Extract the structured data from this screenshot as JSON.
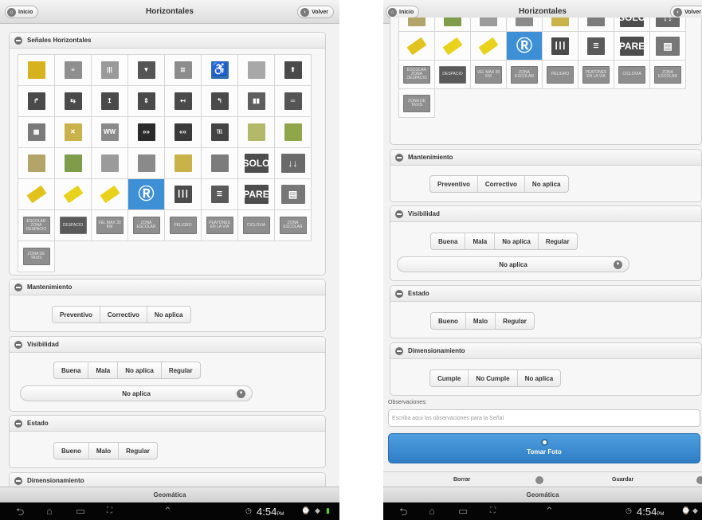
{
  "header": {
    "title": "Horizontales",
    "home_label": "Inicio",
    "back_label": "Volver"
  },
  "signals": {
    "title": "Señales Horizontales",
    "tiles": [
      {
        "label": "",
        "color": "#d6b21f",
        "kind": "hatch-yellow"
      },
      {
        "label": "≡",
        "color": "#8f8f8f",
        "kind": "bars"
      },
      {
        "label": "|||",
        "color": "#9a9a9a",
        "kind": "bars"
      },
      {
        "label": "▼",
        "color": "#555555",
        "kind": "yield"
      },
      {
        "label": "≣",
        "color": "#8c8c8c",
        "kind": "bars"
      },
      {
        "label": "♿",
        "color": "#2d6fb0",
        "kind": "accessible"
      },
      {
        "label": "",
        "color": "#a8a8a8",
        "kind": "plain"
      },
      {
        "label": "⬆",
        "color": "#4a4a4a",
        "kind": "arrow"
      },
      {
        "label": "↱",
        "color": "#4a4a4a",
        "kind": "arrow"
      },
      {
        "label": "⇆",
        "color": "#4a4a4a",
        "kind": "arrow"
      },
      {
        "label": "↥",
        "color": "#4a4a4a",
        "kind": "arrow"
      },
      {
        "label": "⇕",
        "color": "#4a4a4a",
        "kind": "arrow"
      },
      {
        "label": "↤",
        "color": "#4a4a4a",
        "kind": "arrow"
      },
      {
        "label": "↰",
        "color": "#4a4a4a",
        "kind": "arrow"
      },
      {
        "label": "▮▮",
        "color": "#5e5e5e",
        "kind": "lanes"
      },
      {
        "label": "═",
        "color": "#555555",
        "kind": "lanes"
      },
      {
        "label": "▦",
        "color": "#7a7a7a",
        "kind": "cross"
      },
      {
        "label": "✕",
        "color": "#c9b24a",
        "kind": "box"
      },
      {
        "label": "WW",
        "color": "#8a8a8a",
        "kind": "zigzag"
      },
      {
        "label": "»»",
        "color": "#2a2a2a",
        "kind": "chevron"
      },
      {
        "label": "««",
        "color": "#3a3a3a",
        "kind": "chevron"
      },
      {
        "label": "\\\\\\",
        "color": "#444444",
        "kind": "chevron"
      },
      {
        "label": "",
        "color": "#b4b96a",
        "kind": "curb"
      },
      {
        "label": "",
        "color": "#8fa64a",
        "kind": "curb"
      },
      {
        "label": "",
        "color": "#b3a56a",
        "kind": "curb"
      },
      {
        "label": "",
        "color": "#7f9c4a",
        "kind": "curb"
      },
      {
        "label": "",
        "color": "#9b9b9b",
        "kind": "dots"
      },
      {
        "label": "",
        "color": "#8a8a8a",
        "kind": "crosswalk"
      },
      {
        "label": "",
        "color": "#c9b24a",
        "kind": "diagonal"
      },
      {
        "label": "",
        "color": "#7c7c7c",
        "kind": "lanes"
      },
      {
        "label": "SOLO",
        "color": "#4d4d4d",
        "kind": "word"
      },
      {
        "label": "↓↓",
        "color": "#6a6a6a",
        "kind": "word"
      },
      {
        "label": "",
        "color": "#e2c21c",
        "kind": "block"
      },
      {
        "label": "",
        "color": "#e8d21c",
        "kind": "stud"
      },
      {
        "label": "",
        "color": "#e8d21c",
        "kind": "stud"
      },
      {
        "label": "Ⓡ",
        "color": "#3d8fd6",
        "kind": "noparking"
      },
      {
        "label": "┃┃┃",
        "color": "#4a4a4a",
        "kind": "lanes"
      },
      {
        "label": "☰",
        "color": "#5a5a5a",
        "kind": "lanes"
      },
      {
        "label": "PARE",
        "color": "#4d4d4d",
        "kind": "word"
      },
      {
        "label": "▤",
        "color": "#777777",
        "kind": "word"
      },
      {
        "label": "ESCOLAR ZONA DESPACIO",
        "color": "#8e8e8e",
        "kind": "text"
      },
      {
        "label": "DESPACIO",
        "color": "#5a5a5a",
        "kind": "text"
      },
      {
        "label": "VEL MAX 30 KM",
        "color": "#8e8e8e",
        "kind": "text"
      },
      {
        "label": "ZONA ESCOLAR",
        "color": "#8e8e8e",
        "kind": "text"
      },
      {
        "label": "PELIGRO",
        "color": "#8e8e8e",
        "kind": "text"
      },
      {
        "label": "PEATONES EN LA VIA",
        "color": "#8e8e8e",
        "kind": "text"
      },
      {
        "label": "CICLOVIA",
        "color": "#8e8e8e",
        "kind": "text"
      },
      {
        "label": "ZONA ESCOLAR",
        "color": "#8e8e8e",
        "kind": "text"
      },
      {
        "label": "ZONA DE TAXIS",
        "color": "#8e8e8e",
        "kind": "text"
      }
    ],
    "selected_index": 35
  },
  "mantenimiento": {
    "title": "Mantenimiento",
    "options": [
      "Preventivo",
      "Correctivo",
      "No aplica"
    ]
  },
  "visibilidad": {
    "title": "Visibilidad",
    "options": [
      "Buena",
      "Mala",
      "No aplica",
      "Regular"
    ],
    "select_value": "No aplica"
  },
  "estado": {
    "title": "Estado",
    "options": [
      "Bueno",
      "Malo",
      "Regular"
    ]
  },
  "dimensionamiento": {
    "title": "Dimensionamiento",
    "options": [
      "Cumple",
      "No Cumple",
      "No aplica"
    ]
  },
  "observaciones": {
    "label": "Observaciones:",
    "placeholder": "Escriba aquí las observaciones para la Señal"
  },
  "photo": {
    "label": "Tomar Foto"
  },
  "actions": {
    "delete_label": "Borrar",
    "save_label": "Guardar"
  },
  "footer": {
    "label": "Geomática"
  },
  "statusbar": {
    "time": "4:54",
    "ampm": "PM"
  },
  "colors": {
    "accent": "#3d8fd6",
    "selected_cell": "#3d8fd6"
  }
}
